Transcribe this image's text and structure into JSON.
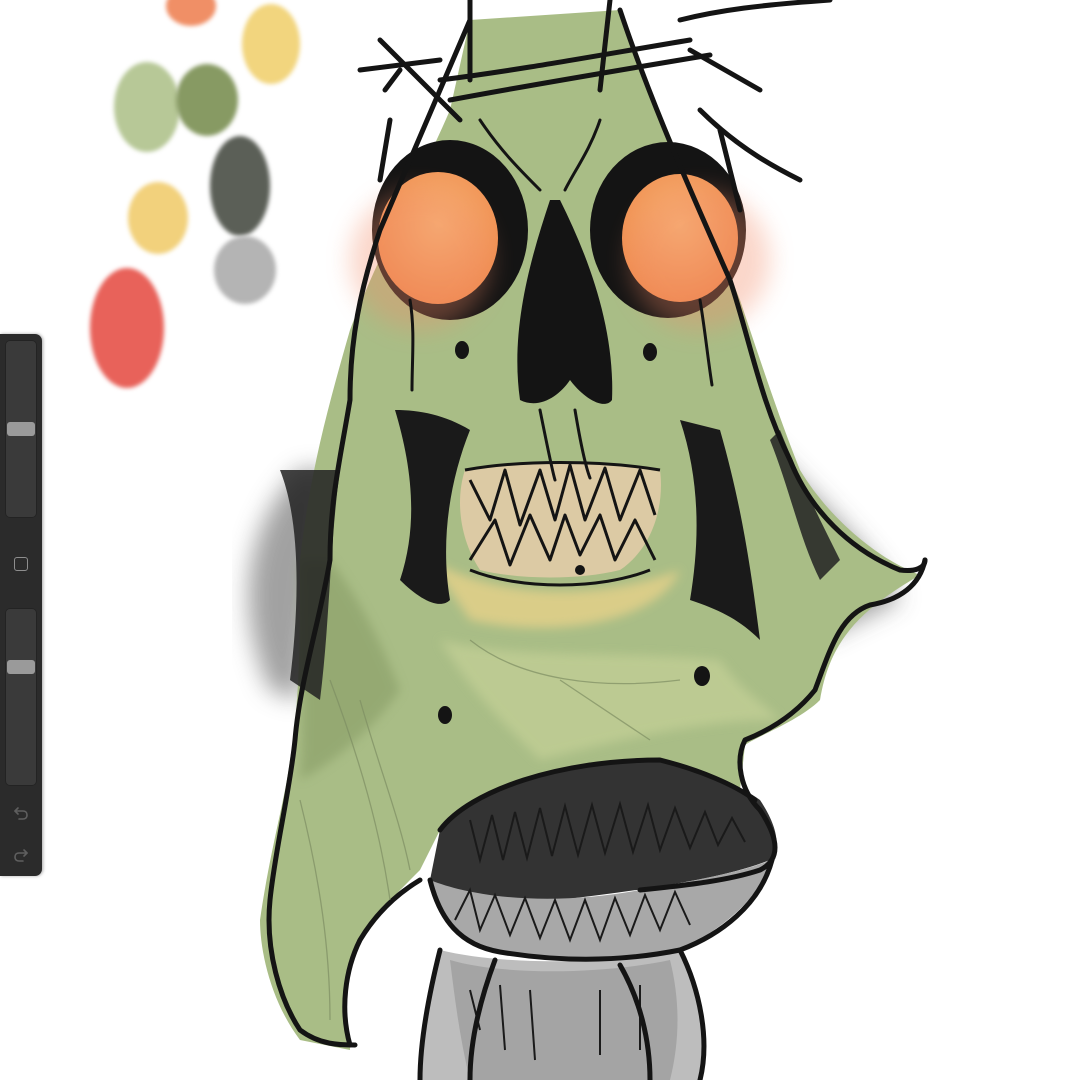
{
  "app": {
    "canvas_background": "#ffffff",
    "toolbar_color": "#2b2b2b"
  },
  "palette": {
    "swatches": [
      {
        "name": "orange",
        "color": "#f08f66"
      },
      {
        "name": "pale-yellow",
        "color": "#f2d57e"
      },
      {
        "name": "sage-green",
        "color": "#b7c897"
      },
      {
        "name": "olive-green",
        "color": "#879a63"
      },
      {
        "name": "dark-gray",
        "color": "#5b5f57"
      },
      {
        "name": "mustard-yellow",
        "color": "#f2d17c"
      },
      {
        "name": "light-gray",
        "color": "#b4b4b4"
      },
      {
        "name": "coral-red",
        "color": "#e8625a"
      }
    ]
  },
  "toolbar": {
    "brush_size_level": 0.45,
    "opacity_level": 0.3,
    "icons": {
      "modify": "square-icon",
      "undo": "undo-icon",
      "redo": "redo-icon"
    }
  },
  "artwork": {
    "skin_color": "#a9bd86",
    "skin_dark": "#889d66",
    "eye_glow": "#f4a464",
    "ink": "#141414",
    "mouth_gray": "#a8a8a8",
    "shadow_gray": "#555555"
  }
}
